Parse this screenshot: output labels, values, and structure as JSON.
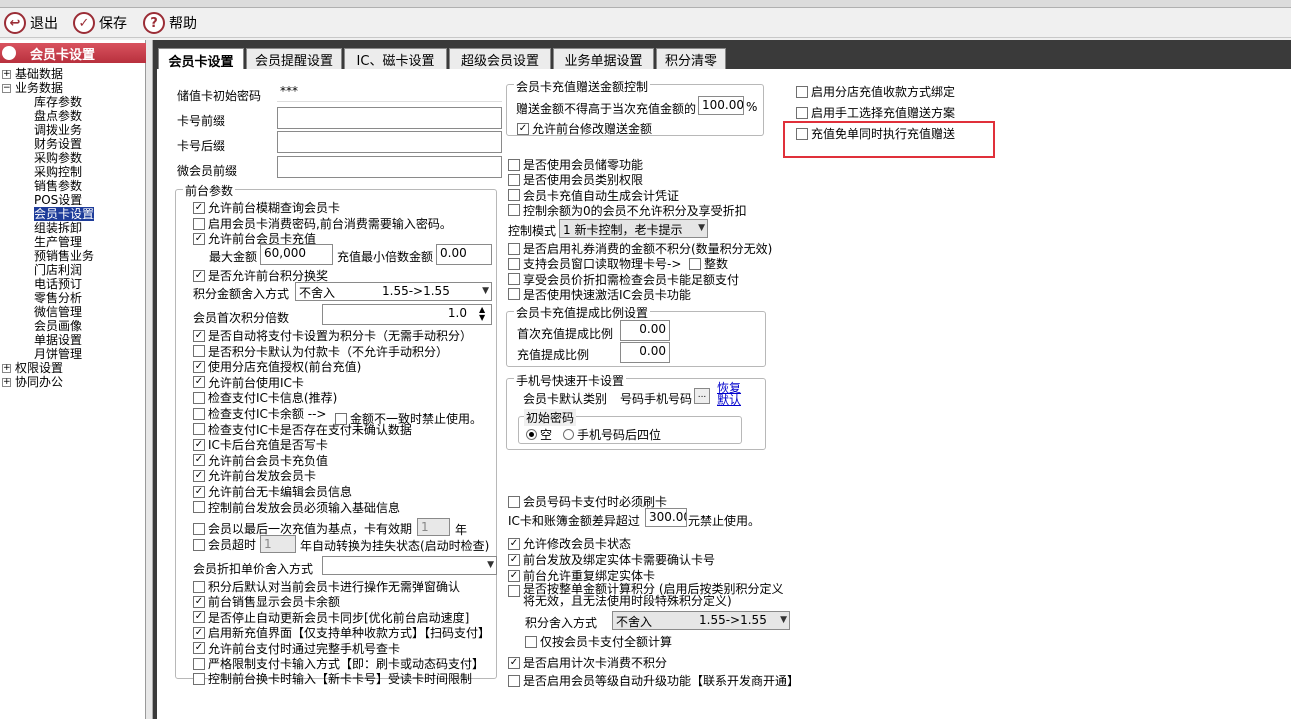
{
  "toolbar": {
    "exit": "退出",
    "save": "保存",
    "help": "帮助"
  },
  "sidebar": {
    "title": "会员卡设置",
    "groups": {
      "basic": "基础数据",
      "business": "业务数据",
      "perm": "权限设置",
      "office": "协同办公"
    },
    "items": [
      "库存参数",
      "盘点参数",
      "调拨业务",
      "财务设置",
      "采购参数",
      "采购控制",
      "销售参数",
      "POS设置",
      "会员卡设置",
      "组装拆卸",
      "生产管理",
      "预销售业务",
      "门店利润",
      "电话预订",
      "零售分析",
      "微信管理",
      "会员画像",
      "单据设置",
      "月饼管理"
    ]
  },
  "tabs": [
    "会员卡设置",
    "会员提醒设置",
    "IC、磁卡设置",
    "超级会员设置",
    "业务单据设置",
    "积分清零"
  ],
  "basic_fields": {
    "init_password_label": "储值卡初始密码",
    "init_password_value": "***",
    "prefix_label": "卡号前缀",
    "suffix_label": "卡号后缀",
    "wechat_prefix_label": "微会员前缀"
  },
  "front": {
    "title": "前台参数",
    "cb1": "允许前台模糊查询会员卡",
    "cb2": "启用会员卡消费密码,前台消费需要输入密码。",
    "cb3": "允许前台会员卡充值",
    "max_label": "最大金额",
    "max_value": "60,000",
    "min_mult_label": "充值最小倍数金额",
    "min_mult_value": "0.00",
    "cb4": "是否允许前台积分换奖",
    "round_label": "积分金额舍入方式",
    "round_mode": "不舍入",
    "round_example": "1.55->1.55",
    "first_mult_label": "会员首次积分倍数",
    "first_mult_value": "1.0",
    "list": [
      "是否自动将支付卡设置为积分卡（无需手动积分）",
      "是否积分卡默认为付款卡（不允许手动积分）",
      "使用分店充值授权(前台充值)",
      "允许前台使用IC卡",
      "检查支付IC卡信息(推荐)",
      "检查支付IC卡余额 -->",
      "检查支付IC卡是否存在支付未确认数据",
      "IC卡后台充值是否写卡",
      "允许前台会员卡充负值",
      "允许前台发放会员卡",
      "允许前台无卡编辑会员信息",
      "控制前台发放会员必须输入基础信息"
    ],
    "mismatch": "金额不一致时禁止使用。",
    "base_point": "会员以最后一次充值为基点，卡有效期",
    "base_point_value": "1",
    "year": "年",
    "overdue": "会员超时",
    "overdue_value": "1",
    "overdue_tail": "年自动转换为挂失状态(启动时检查)",
    "discount_round_label": "会员折扣单价舍入方式",
    "list2": [
      "积分后默认对当前会员卡进行操作无需弹窗确认",
      "前台销售显示会员卡余额",
      "是否停止自动更新会员卡同步[优化前台启动速度]",
      "启用新充值界面【仅支持单种收款方式】【扫码支付】",
      "允许前台支付时通过完整手机号查卡",
      "严格限制支付卡输入方式【即：刷卡或动态码支付】",
      "控制前台换卡时输入【新卡卡号】受读卡时间限制"
    ]
  },
  "gift": {
    "title": "会员卡充值赠送金额控制",
    "limit_label": "赠送金额不得高于当次充值金额的",
    "limit_value": "100.00",
    "pct": "%",
    "allow_modify": "允许前台修改赠送金额"
  },
  "mid": {
    "list": [
      "是否使用会员储零功能",
      "是否使用会员类别权限",
      "会员卡充值自动生成会计凭证",
      "控制余额为0的会员不允许积分及享受折扣"
    ],
    "mode_label": "控制模式",
    "mode_value": "1 新卡控制，老卡提示",
    "list2": [
      "是否启用礼券消费的金额不积分(数量积分无效)",
      "支持会员窗口读取物理卡号->",
      "享受会员价折扣需检查会员卡能足额支付",
      "是否使用快速激活IC会员卡功能"
    ],
    "whole": "整数"
  },
  "commission": {
    "title": "会员卡充值提成比例设置",
    "first_label": "首次充值提成比例",
    "first_value": "0.00",
    "rate_label": "充值提成比例",
    "rate_value": "0.00"
  },
  "phone": {
    "title": "手机号快速开卡设置",
    "type_label": "会员卡默认类别",
    "type_value": "号码手机号码",
    "restore": "恢复",
    "default": "默认",
    "pwd_title": "初始密码",
    "opt_empty": "空",
    "opt_last4": "手机号码后四位"
  },
  "lower": {
    "must_swipe": "会员号码卡支付时必须刷卡",
    "diff_label": "IC卡和账簿金额差异超过",
    "diff_value": "300.00",
    "diff_tail": "元禁止使用。",
    "list": [
      "允许修改会员卡状态",
      "前台发放及绑定实体卡需要确认卡号",
      "前台允许重复绑定实体卡"
    ],
    "adjust_line1": "是否按整单金额计算积分 (启用后按类别积分定义",
    "adjust_line2": "将无效，且无法使用时段特殊积分定义)",
    "round_label": "积分舍入方式",
    "round_mode": "不舍入",
    "round_example": "1.55->1.55",
    "only_balance": "仅按会员卡支付全额计算",
    "times_card": "是否启用计次卡消费不积分",
    "upgrade": "是否启用会员等级自动升级功能【联系开发商开通】"
  },
  "right": {
    "branch": "启用分店充值收款方式绑定",
    "manual": "启用手工选择充值赠送方案",
    "free_order": "充值免单同时执行充值赠送"
  }
}
